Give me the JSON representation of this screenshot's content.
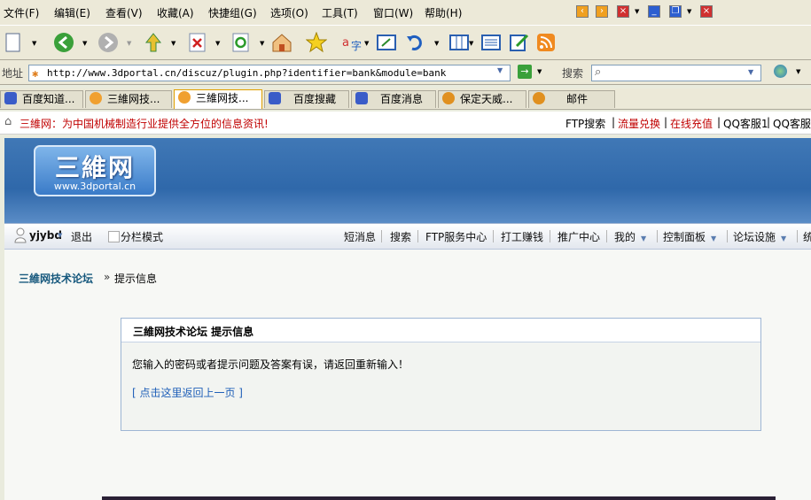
{
  "menu": [
    "文件(F)",
    "编辑(E)",
    "查看(V)",
    "收藏(A)",
    "快捷组(G)",
    "选项(O)",
    "工具(T)",
    "窗口(W)",
    "帮助(H)"
  ],
  "address": {
    "label": "地址",
    "url": "http://www.3dportal.cn/discuz/plugin.php?identifier=bank&module=bank",
    "search_label": "搜索"
  },
  "tabs": [
    {
      "label": "百度知道..."
    },
    {
      "label": "三維网技..."
    },
    {
      "label": "三維网技..."
    },
    {
      "label": "百度搜藏"
    },
    {
      "label": "百度消息"
    },
    {
      "label": "保定天威..."
    },
    {
      "label": "邮件"
    }
  ],
  "infobar": {
    "slogan": "三維网：为中国机械制造行业提供全方位的信息资讯!",
    "links": [
      "FTP搜索",
      "流量兑换",
      "在线充值",
      "QQ客服1",
      "QQ客服"
    ]
  },
  "site": {
    "logo_title": "三維网",
    "logo_url": "www.3dportal.cn"
  },
  "usernav": {
    "username": "yjybd",
    "logout": "退出",
    "split_mode": "分栏模式",
    "links": [
      "短消息",
      "搜索",
      "FTP服务中心",
      "打工赚钱",
      "推广中心",
      "我的",
      "控制面板",
      "论坛设施",
      "统"
    ]
  },
  "breadcrumb": {
    "home": "三維网技术论坛",
    "separator": "»",
    "current": "提示信息"
  },
  "message": {
    "title": "三維网技术论坛  提示信息",
    "text": "您输入的密码或者提示问题及答案有误，请返回重新输入！",
    "back_link": "[ 点击这里返回上一页 ]"
  },
  "colors": {
    "banner": "#2f68aa",
    "link": "#1f5fb8",
    "slogan": "#c00000"
  }
}
